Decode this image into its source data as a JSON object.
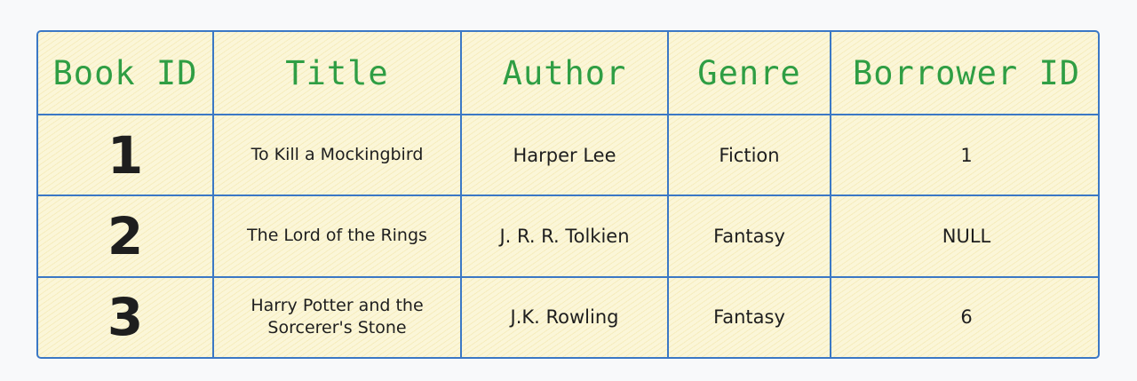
{
  "table": {
    "headers": [
      "Book ID",
      "Title",
      "Author",
      "Genre",
      "Borrower ID"
    ],
    "rows": [
      {
        "book_id": "1",
        "title": "To Kill a Mockingbird",
        "author": "Harper Lee",
        "genre": "Fiction",
        "borrower_id": "1"
      },
      {
        "book_id": "2",
        "title": "The Lord of the Rings",
        "author": "J. R. R. Tolkien",
        "genre": "Fantasy",
        "borrower_id": "NULL"
      },
      {
        "book_id": "3",
        "title": "Harry Potter and the Sorcerer's Stone",
        "author": "J.K. Rowling",
        "genre": "Fantasy",
        "borrower_id": "6"
      }
    ]
  },
  "colors": {
    "border": "#3b78c5",
    "header_text": "#2f9e44",
    "body_text": "#1e1e1e",
    "fill": "#fbf6d8"
  }
}
